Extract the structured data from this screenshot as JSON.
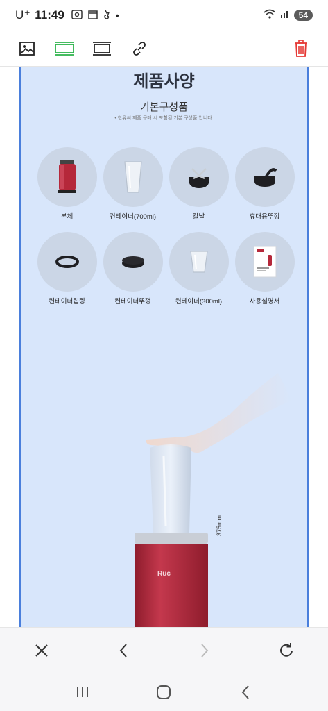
{
  "status_bar": {
    "carrier": "U⁺",
    "time": "11:49",
    "battery": "54"
  },
  "colors": {
    "accent_green": "#2bb34a",
    "danger_red": "#e53935",
    "doc_bg": "#d8e6fb",
    "doc_border": "#4a7fdc",
    "blender_red": "#b5283a"
  },
  "toolbar": {
    "items": [
      {
        "name": "image-icon"
      },
      {
        "name": "fit-width-icon",
        "active": true
      },
      {
        "name": "fit-page-icon"
      },
      {
        "name": "link-icon"
      },
      {
        "name": "trash-icon"
      }
    ]
  },
  "document": {
    "title": "제품사양",
    "subtitle": "기본구성품",
    "note": "• 한유씨 제품 구매 시 포함된 기본 구성품 입니다.",
    "components": [
      {
        "label": "본체",
        "icon": "blender-base"
      },
      {
        "label": "컨테이너(700ml)",
        "icon": "container-large"
      },
      {
        "label": "칼날",
        "icon": "blade"
      },
      {
        "label": "휴대용뚜껑",
        "icon": "portable-lid"
      },
      {
        "label": "컨테이너립링",
        "icon": "lip-ring"
      },
      {
        "label": "컨테이너뚜껑",
        "icon": "container-lid"
      },
      {
        "label": "컨테이너(300ml)",
        "icon": "container-small"
      },
      {
        "label": "사용설명서",
        "icon": "manual"
      }
    ],
    "dimension_label": "375mm",
    "brand_mark": "Ruc"
  },
  "bottom_bar": {
    "items": [
      "close-icon",
      "back-icon",
      "forward-icon",
      "refresh-icon"
    ]
  },
  "nav_bar": {
    "items": [
      "recent-apps-icon",
      "home-icon",
      "back-nav-icon"
    ]
  }
}
